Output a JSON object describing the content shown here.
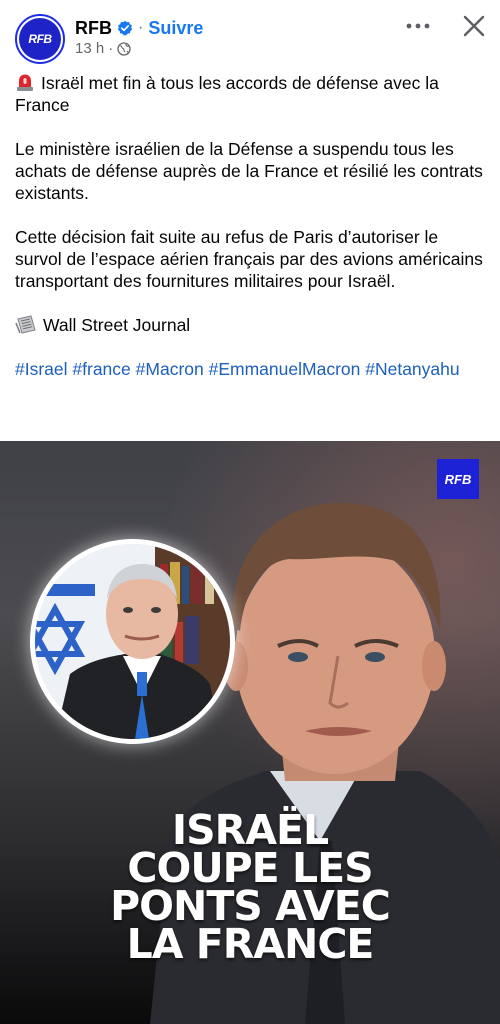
{
  "header": {
    "avatar_text": "RFB",
    "page_name": "RFB",
    "separator": "·",
    "follow_label": "Suivre",
    "timestamp": "13 h",
    "meta_separator": "·"
  },
  "post": {
    "title": "Israël met fin à tous les accords de défense avec la France",
    "paragraph_1": "Le ministère israélien de la Défense a suspendu tous les achats de défense auprès de la France et résilié les contrats existants.",
    "paragraph_2": "Cette décision fait suite au refus de Paris d’autoriser le survol de l’espace aérien français par des avions américains transportant des fournitures militaires pour Israël.",
    "source": "Wall Street Journal",
    "hashtags": [
      "#Israel",
      "#france",
      "#Macron",
      "#EmmanuelMacron",
      "#Netanyahu"
    ]
  },
  "image": {
    "logo_text": "RFB",
    "headline": [
      "ISRAËL",
      "COUPE LES",
      "PONTS AVEC",
      "LA FRANCE"
    ]
  },
  "colors": {
    "accent": "#1877f2",
    "hashtag": "#1d5fbf",
    "brand_blue": "#1d23c7"
  },
  "icons": {
    "verified": "verified-badge-icon",
    "globe": "globe-icon",
    "more": "more-options-icon",
    "close": "close-icon",
    "siren": "siren-icon",
    "newspaper": "newspaper-icon"
  }
}
